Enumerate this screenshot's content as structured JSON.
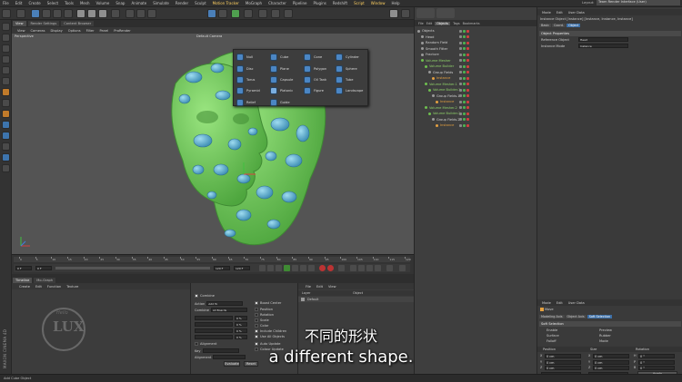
{
  "menubar": {
    "items": [
      "File",
      "Edit",
      "Create",
      "Select",
      "Tools",
      "Mesh",
      "Volume",
      "Snap",
      "Animate",
      "Simulate",
      "Render",
      "Sculpt",
      "Motion Tracker",
      "MoGraph",
      "Character",
      "Pipeline",
      "Plugins",
      "Redshift",
      "Script",
      "Window",
      "Help"
    ],
    "layout_label": "Layout:",
    "layout_value": "Team Render Interface (User)"
  },
  "viewport_tabs": [
    "View",
    "Render Settings",
    "Content Browser"
  ],
  "viewport_menu": [
    "View",
    "Cameras",
    "Display",
    "Options",
    "Filter",
    "Panel",
    "ProRender"
  ],
  "viewport": {
    "name": "Perspective",
    "camera": "Default Camera"
  },
  "primitives_popup": {
    "columns": [
      [
        "Null",
        "Disc",
        "Torus",
        "Pyramid",
        "Relief"
      ],
      [
        "Cube",
        "Plane",
        "Capsule",
        "Platonic",
        "Guide"
      ],
      [
        "Cone",
        "Polygon",
        "Oil Tank",
        "Figure"
      ],
      [
        "Cylinder",
        "Sphere",
        "Tube",
        "Landscape"
      ]
    ],
    "selected": "Platonic"
  },
  "timeline": {
    "ticks": [
      "0",
      "5",
      "10",
      "15",
      "20",
      "25",
      "30",
      "35",
      "40",
      "45",
      "50",
      "55",
      "60",
      "65",
      "70",
      "75",
      "80",
      "85",
      "90",
      "95",
      "100",
      "105",
      "110",
      "115",
      "120"
    ],
    "current_frame": "0 F",
    "start_frame": "0 F",
    "end_frame": "120 F",
    "end_frame_2": "120 F"
  },
  "bottom_tabs": [
    "Timeline",
    "Mo-Graph"
  ],
  "materials": {
    "menu": [
      "Create",
      "Edit",
      "Function",
      "Texture"
    ],
    "watermark_big": "LUX",
    "watermark_small": "Hello"
  },
  "config_panel": {
    "enabled_label": "Combine",
    "action_label": "Action",
    "action_value": "Add To",
    "combine_label": "Combine",
    "combine_value": "All Boards",
    "boost_label": "Boost Center",
    "rows": [
      {
        "label": "Position",
        "value": "0 %"
      },
      {
        "label": "Rotation",
        "value": "0 %"
      },
      {
        "label": "Scale",
        "value": "0 %"
      },
      {
        "label": "Color",
        "value": "0 %"
      }
    ],
    "include_children": "Include Children",
    "use_all_objects": "Use All Objects",
    "alignment_label": "Alignment",
    "auto_update": "Auto Update",
    "colour_update": "Colour Update",
    "key_label": "Key",
    "alignment2_label": "Alignment",
    "evaluate_button": "Evaluate",
    "reset_button": "Reset"
  },
  "layer_panel": {
    "menu": [
      "File",
      "Edit",
      "View"
    ],
    "header_layer": "Layer",
    "header_object": "Object",
    "row_default": "Default"
  },
  "object_manager": {
    "menu": [
      "File",
      "Edit",
      "Objects",
      "Tags",
      "Bookmarks"
    ],
    "objects": [
      {
        "name": "Objects",
        "color": "plain"
      },
      {
        "name": "Head",
        "color": "plain"
      },
      {
        "name": "Random Field",
        "color": "plain"
      },
      {
        "name": "Smooth Fitter",
        "color": "plain"
      },
      {
        "name": "Fracture",
        "color": "plain"
      },
      {
        "name": "Volume Mesher",
        "color": "green"
      },
      {
        "name": "Volume Builder",
        "color": "green"
      },
      {
        "name": "Group Fields",
        "color": "plain"
      },
      {
        "name": "Instance",
        "color": "orange"
      },
      {
        "name": "Volume Mesher.1",
        "color": "green"
      },
      {
        "name": "Volume Builder.1",
        "color": "green"
      },
      {
        "name": "Group Fields.1",
        "color": "plain"
      },
      {
        "name": "Instance",
        "color": "orange"
      },
      {
        "name": "Volume Mesher.2",
        "color": "green"
      },
      {
        "name": "Volume Builder.2",
        "color": "green"
      },
      {
        "name": "Group Fields.2",
        "color": "plain"
      },
      {
        "name": "Instance",
        "color": "orange"
      }
    ]
  },
  "attributes": {
    "menu": [
      "Mode",
      "Edit",
      "User Data"
    ],
    "title": "Instance Object [Instance] [Instance, Instance, Instance]",
    "tabs": [
      "Basic",
      "Coord.",
      "Object"
    ],
    "active_tab": "Object",
    "section": "Object Properties",
    "reference_label": "Reference Object",
    "reference_value": "Head",
    "instance_mode_label": "Instance Mode",
    "instance_mode_value": "Instance",
    "bottom_menu": [
      "Mode",
      "Edit",
      "User Data"
    ],
    "bottom_object": "Move",
    "bottom_tabs": [
      "Modeling Axis",
      "Object Axis",
      "Soft Selection"
    ],
    "bottom_active": "Soft Selection",
    "soft_section": "Soft Selection",
    "soft_rows": [
      "Enable",
      "Surface",
      "Falloff"
    ],
    "soft_rows_right": [
      "Preview",
      "Rubber",
      "Mode"
    ],
    "psr_headers": [
      "Position",
      "Size",
      "Rotation"
    ],
    "psr_rows": [
      {
        "axis": "X",
        "pos": "0 cm",
        "size": "0 cm",
        "rot_label": "H",
        "rot": "0 °"
      },
      {
        "axis": "Y",
        "pos": "0 cm",
        "size": "0 cm",
        "rot_label": "P",
        "rot": "0 °"
      },
      {
        "axis": "Z",
        "pos": "0 cm",
        "size": "0 cm",
        "rot_label": "B",
        "rot": "0 °"
      }
    ],
    "object_mode": "Object (Rel)",
    "size_mode": "Size",
    "apply_button": "Apply"
  },
  "status": {
    "text": "Add Cube Object"
  },
  "brand": {
    "vertical_text": "MAXON CINEMA 4D"
  },
  "subtitle": {
    "chinese": "不同的形状",
    "english": "a different shape."
  },
  "colors": {
    "head_green": "#7cd36a",
    "blob_blue": "#59b4d8",
    "accent_blue": "#4a86c4",
    "orange": "#e4a040"
  }
}
